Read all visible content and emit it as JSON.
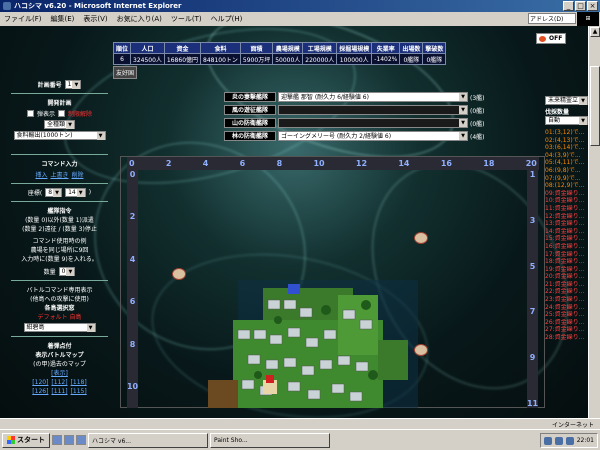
{
  "window": {
    "title": "ハコシマ v6.20 - Microsoft Internet Explorer",
    "controls": [
      "_",
      "□",
      "×"
    ]
  },
  "menu": [
    "ファイル(F)",
    "編集(E)",
    "表示(V)",
    "お気に入り(A)",
    "ツール(T)",
    "ヘルプ(H)"
  ],
  "address_label": "アドレス(D)",
  "stats": {
    "headers": [
      "順位",
      "人口",
      "資金",
      "食料",
      "面積",
      "農場規模",
      "工場規模",
      "採掘場規模",
      "失業率",
      "出場数",
      "撃破数"
    ],
    "values": [
      "6",
      "324500人",
      "16860億円",
      "848100トン",
      "5900万坪",
      "50000人",
      "220000人",
      "100000人",
      "-1402%",
      "0艦隊",
      "0艦隊"
    ]
  },
  "toggle": {
    "label": "OFF"
  },
  "friend_label": "友好国",
  "left": {
    "plan_no_label": "計画番号",
    "plan_no_value": "1",
    "dev_plan_label": "開発計画",
    "check1": "弾表示",
    "check2": "制限解除",
    "category": "全種類",
    "plan_select": "食料輸出(1000トン)",
    "command_label": "コマンド入力",
    "cmd_insert": "挿入",
    "cmd_overwrite": "上書き",
    "cmd_delete": "削除",
    "coord_label": "座標(",
    "coord_x": "8",
    "coord_y": "14",
    "coord_close": ")",
    "fleet_cmd_label": "艦隊指令",
    "fleet_desc": [
      "(数量 0)以外(数量 1)派遣",
      "(数量 2)遠征 / (数量 3)停止"
    ],
    "cmd_example_title": "コマンド使用時の例",
    "cmd_example": [
      "農場を同じ場所に9回",
      "入力時に(数量 9)を入れる。"
    ],
    "quantity_label": "数量",
    "quantity_value": "0",
    "battle_label": "バトルコマンド専用表示",
    "battle_desc": "(他島への攻撃に使用)",
    "island_label": "各島選択窓",
    "island_warn": "デフォルト 自島",
    "island_select": "紺碧島",
    "catchup_label": "着弾点付",
    "battle_map_label": "表示バトルマップ",
    "past_map_label": "(の甲)過去のマップ",
    "show_label": "[表示]",
    "links": [
      "[120]",
      "[112]",
      "[118]",
      "[126]",
      "[111]",
      "[115]"
    ]
  },
  "officers": [
    {
      "label": "炎の妻擊艦隊",
      "value": "迎撃艦 那智 (耐久力 6/経験値 6)",
      "count": "(3艦)"
    },
    {
      "label": "風の遊征艦隊",
      "value": "",
      "count": "(0艦)"
    },
    {
      "label": "山の防衛艦隊",
      "value": "",
      "count": "(0艦)"
    },
    {
      "label": "林の防衛艦隊",
      "value": "ゴーイングメリー号 (耐久力 2/経験値 6)",
      "count": "(4艦)"
    }
  ],
  "map": {
    "col_labels": [
      "0",
      "2",
      "4",
      "6",
      "8",
      "10",
      "12",
      "14",
      "16",
      "18",
      "20"
    ],
    "row_labels_left": [
      "0",
      "",
      "2",
      "",
      "4",
      "",
      "6",
      "",
      "8",
      "",
      "10",
      ""
    ],
    "row_labels_right": [
      "1",
      "3",
      "5",
      "7",
      "9",
      "11"
    ]
  },
  "right": {
    "box1": "未来精霊立",
    "label": "伐採数量",
    "box2": "自動",
    "list": [
      {
        "t": "01:(3,12)で...",
        "c": "o"
      },
      {
        "t": "02:(4,13)で...",
        "c": "o"
      },
      {
        "t": "03:(6,14)で...",
        "c": "o"
      },
      {
        "t": "04:(3,9)で...",
        "c": "o"
      },
      {
        "t": "05:(4,11)で...",
        "c": "o"
      },
      {
        "t": "06:(9,8)で...",
        "c": "o"
      },
      {
        "t": "07:(9,9)で...",
        "c": "o"
      },
      {
        "t": "08:(12,9)で...",
        "c": "o"
      },
      {
        "t": "09:資金繰り...",
        "c": "r"
      },
      {
        "t": "10:資金繰り...",
        "c": "r"
      },
      {
        "t": "11:資金繰り...",
        "c": "r"
      },
      {
        "t": "12:資金繰り...",
        "c": "r"
      },
      {
        "t": "13:資金繰り...",
        "c": "r"
      },
      {
        "t": "14:資金繰り...",
        "c": "r"
      },
      {
        "t": "15:資金繰り...",
        "c": "r"
      },
      {
        "t": "16:資金繰り...",
        "c": "r"
      },
      {
        "t": "17:資金繰り...",
        "c": "r"
      },
      {
        "t": "18:資金繰り...",
        "c": "r"
      },
      {
        "t": "19:資金繰り...",
        "c": "r"
      },
      {
        "t": "20:資金繰り...",
        "c": "r"
      },
      {
        "t": "21:資金繰り...",
        "c": "r"
      },
      {
        "t": "22:資金繰り...",
        "c": "r"
      },
      {
        "t": "23:資金繰り...",
        "c": "r"
      },
      {
        "t": "24:資金繰り...",
        "c": "r"
      },
      {
        "t": "25:資金繰り...",
        "c": "r"
      },
      {
        "t": "26:資金繰り...",
        "c": "r"
      },
      {
        "t": "27:資金繰り...",
        "c": "r"
      },
      {
        "t": "28:資金繰り...",
        "c": "r"
      }
    ]
  },
  "status": {
    "text": "",
    "zone": "インターネット"
  },
  "taskbar": {
    "start": "スタート",
    "tasks": [
      "ハコシマ v6...",
      "Paint Sho..."
    ],
    "clock": "22:01"
  }
}
